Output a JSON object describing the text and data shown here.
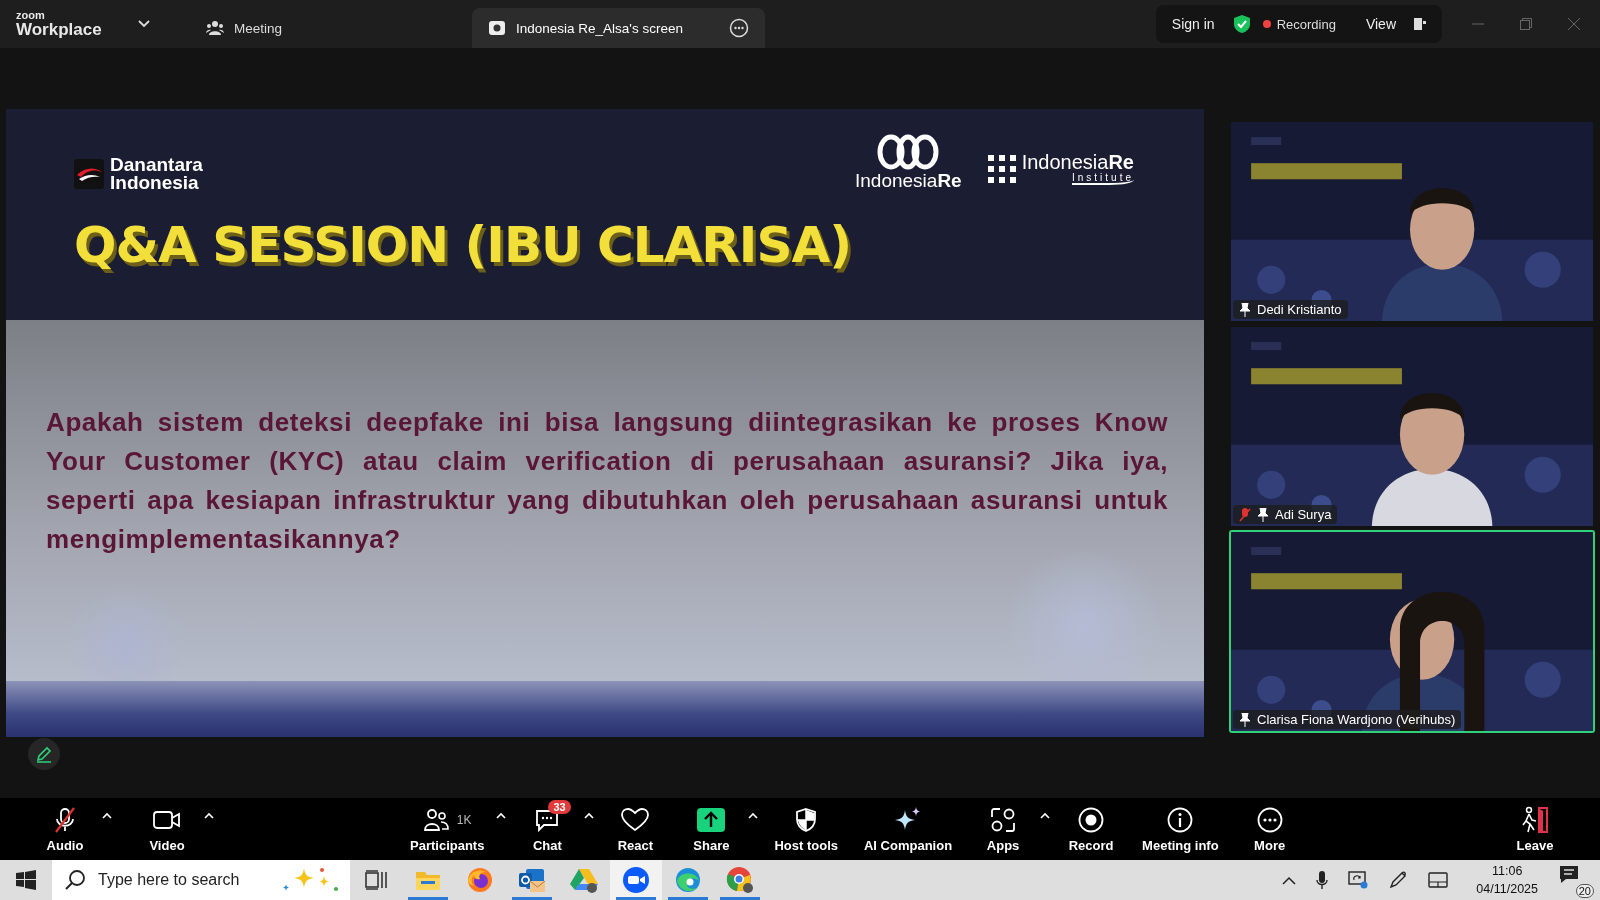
{
  "title_bar": {
    "brand_top": "zoom",
    "brand": "Workplace",
    "tabs": [
      {
        "label": "Meeting",
        "selected": false
      },
      {
        "label": "Indonesia Re_Alsa's screen",
        "selected": true
      }
    ],
    "sign_in": "Sign in",
    "recording": "Recording",
    "view": "View"
  },
  "shared_slide": {
    "logo_left": [
      "Danantara",
      "Indonesia"
    ],
    "logo_center": "Indonesia**Re**",
    "logo_right": "Indonesia**Re**",
    "logo_right_sub": "Institute",
    "title": "Q&A SESSION (IBU CLARISA)",
    "question": "Apakah sistem deteksi deepfake ini bisa langsung diintegrasikan ke proses Know Your Customer (KYC) atau claim verification di perusahaan asuransi? Jika iya, seperti apa kesiapan infrastruktur yang dibutuhkan oleh perusahaan asuransi untuk mengimplementasikannya?"
  },
  "video_tiles": [
    {
      "name": "Dedi Kristianto",
      "muted": false,
      "active": false,
      "pinned": true
    },
    {
      "name": "Adi Surya",
      "muted": true,
      "active": false,
      "pinned": true
    },
    {
      "name": "Clarisa Fiona Wardjono (Verihubs)",
      "muted": false,
      "active": true,
      "pinned": true
    }
  ],
  "toolbar": [
    {
      "kind": "audio",
      "label": "Audio",
      "caret": true,
      "muted": true
    },
    {
      "kind": "video",
      "label": "Video",
      "caret": true
    },
    {
      "kind": "participants",
      "label": "Participants",
      "caret": true,
      "count": "1K"
    },
    {
      "kind": "chat",
      "label": "Chat",
      "caret": true,
      "badge": "33"
    },
    {
      "kind": "react",
      "label": "React",
      "caret": false
    },
    {
      "kind": "share",
      "label": "Share",
      "caret": true
    },
    {
      "kind": "host_tools",
      "label": "Host tools",
      "caret": false
    },
    {
      "kind": "ai_companion",
      "label": "AI Companion",
      "caret": false
    },
    {
      "kind": "apps",
      "label": "Apps",
      "caret": true
    },
    {
      "kind": "record",
      "label": "Record",
      "caret": false
    },
    {
      "kind": "meeting_info",
      "label": "Meeting info",
      "caret": false
    },
    {
      "kind": "more",
      "label": "More",
      "caret": false
    },
    {
      "kind": "leave",
      "label": "Leave",
      "caret": false
    }
  ],
  "taskbar": {
    "search_placeholder": "Type here to search",
    "apps": [
      {
        "kind": "task_view",
        "running": false,
        "selected": false
      },
      {
        "kind": "files",
        "running": true,
        "selected": false
      },
      {
        "kind": "firefox",
        "running": false,
        "selected": false
      },
      {
        "kind": "outlook",
        "running": true,
        "selected": false
      },
      {
        "kind": "drive",
        "running": false,
        "selected": false
      },
      {
        "kind": "zoom",
        "running": true,
        "selected": true
      },
      {
        "kind": "edge",
        "running": true,
        "selected": false
      },
      {
        "kind": "chrome",
        "running": true,
        "selected": false
      }
    ],
    "time": "11:06",
    "date": "04/11/2025",
    "notifications": "20"
  }
}
